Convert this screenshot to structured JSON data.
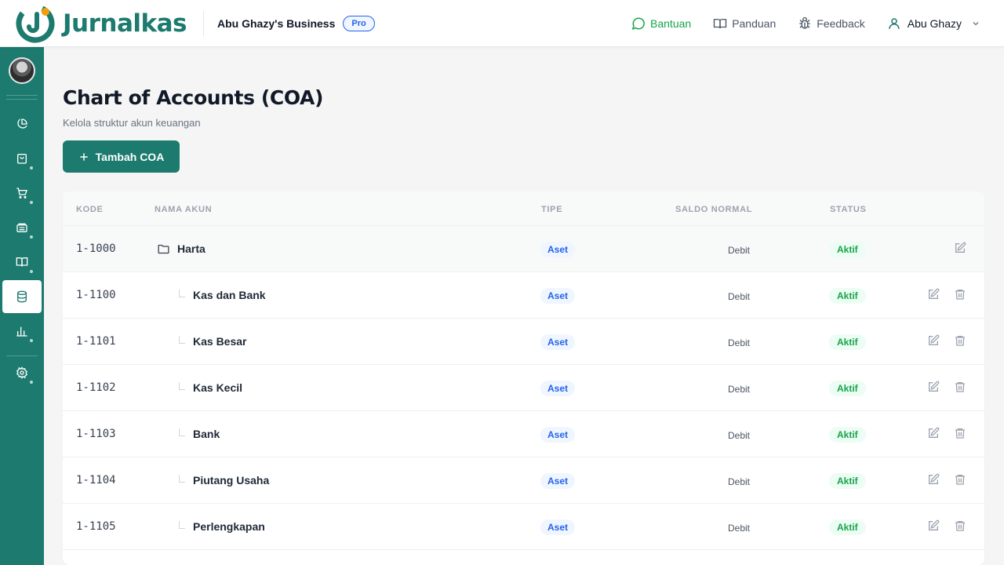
{
  "app": {
    "name": "Jurnalkas",
    "brand_color": "#1c7a6e"
  },
  "business": {
    "name": "Abu Ghazy's Business",
    "plan": "Pro"
  },
  "header_nav": {
    "help": "Bantuan",
    "guide": "Panduan",
    "feedback": "Feedback",
    "user": "Abu Ghazy"
  },
  "sidebar": {
    "items": [
      {
        "icon": "pie-chart-icon",
        "active": false,
        "has_submenu": false
      },
      {
        "icon": "shopping-bag-icon",
        "active": false,
        "has_submenu": true
      },
      {
        "icon": "shopping-cart-icon",
        "active": false,
        "has_submenu": true
      },
      {
        "icon": "wallet-icon",
        "active": false,
        "has_submenu": true
      },
      {
        "icon": "book-icon",
        "active": false,
        "has_submenu": true
      },
      {
        "icon": "database-icon",
        "active": true,
        "has_submenu": false
      },
      {
        "icon": "bar-chart-icon",
        "active": false,
        "has_submenu": true
      },
      {
        "icon": "gear-icon",
        "active": false,
        "has_submenu": true
      }
    ]
  },
  "page": {
    "title": "Chart of Accounts (COA)",
    "subtitle": "Kelola struktur akun keuangan",
    "add_button": "Tambah COA"
  },
  "table": {
    "headers": {
      "kode": "KODE",
      "nama": "NAMA AKUN",
      "tipe": "TIPE",
      "saldo": "SALDO NORMAL",
      "status": "STATUS"
    },
    "rows": [
      {
        "kode": "1-1000",
        "nama": "Harta",
        "tipe": "Aset",
        "saldo": "Debit",
        "status": "Aktif",
        "level": 0
      },
      {
        "kode": "1-1100",
        "nama": "Kas dan Bank",
        "tipe": "Aset",
        "saldo": "Debit",
        "status": "Aktif",
        "level": 1
      },
      {
        "kode": "1-1101",
        "nama": "Kas Besar",
        "tipe": "Aset",
        "saldo": "Debit",
        "status": "Aktif",
        "level": 1
      },
      {
        "kode": "1-1102",
        "nama": "Kas Kecil",
        "tipe": "Aset",
        "saldo": "Debit",
        "status": "Aktif",
        "level": 1
      },
      {
        "kode": "1-1103",
        "nama": "Bank",
        "tipe": "Aset",
        "saldo": "Debit",
        "status": "Aktif",
        "level": 1
      },
      {
        "kode": "1-1104",
        "nama": "Piutang Usaha",
        "tipe": "Aset",
        "saldo": "Debit",
        "status": "Aktif",
        "level": 1
      },
      {
        "kode": "1-1105",
        "nama": "Perlengkapan",
        "tipe": "Aset",
        "saldo": "Debit",
        "status": "Aktif",
        "level": 1
      }
    ]
  }
}
